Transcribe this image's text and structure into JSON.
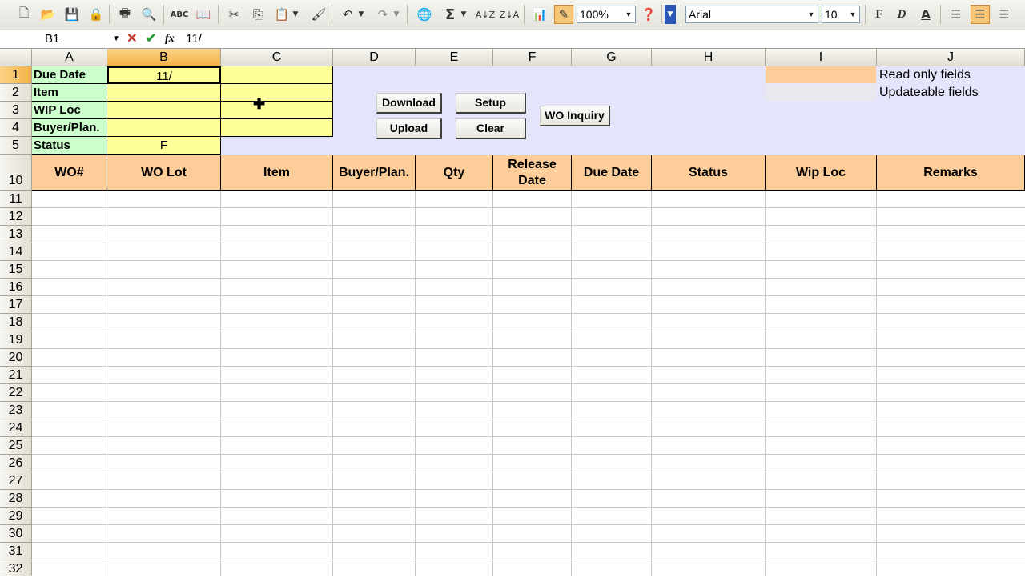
{
  "toolbar": {
    "icons": [
      "new-icon",
      "open-icon",
      "save-icon",
      "permission-icon",
      "print-icon",
      "print-preview-icon",
      "spelling-icon",
      "research-icon",
      "cut-icon",
      "copy-icon",
      "paste-icon",
      "format-painter-icon",
      "undo-icon",
      "redo-icon",
      "hyperlink-icon",
      "autosum-icon",
      "sort-ascending-icon",
      "sort-descending-icon",
      "chart-wizard-icon",
      "drawing-icon",
      "help-icon"
    ],
    "zoom": "100%",
    "font_name": "Arial",
    "font_size": "10",
    "bold": "F",
    "italic": "D",
    "underline": "A"
  },
  "formula_bar": {
    "name_box": "B1",
    "content": "11/"
  },
  "columns": [
    "A",
    "B",
    "C",
    "D",
    "E",
    "F",
    "G",
    "H",
    "I",
    "J"
  ],
  "rows": [
    "1",
    "2",
    "3",
    "4",
    "5",
    "10",
    "11",
    "12",
    "13",
    "14",
    "15",
    "16",
    "17",
    "18",
    "19",
    "20",
    "21",
    "22",
    "23",
    "24",
    "25",
    "26",
    "27",
    "28",
    "29",
    "30",
    "31",
    "32"
  ],
  "criteria": {
    "labels": [
      "Due Date",
      "Item",
      "WIP Loc",
      "Buyer/Plan.",
      "Status"
    ],
    "values": [
      "11/",
      "",
      "",
      "",
      "F"
    ]
  },
  "buttons": {
    "download": "Download",
    "setup": "Setup",
    "upload": "Upload",
    "clear": "Clear",
    "wo_inquiry": "WO Inquiry"
  },
  "legend": {
    "read_only": "Read only fields",
    "updateable": "Updateable fields"
  },
  "headers": [
    "WO#",
    "WO Lot",
    "Item",
    "Buyer/Plan.",
    "Qty",
    "Release Date",
    "Due Date",
    "Status",
    "Wip Loc",
    "Remarks"
  ],
  "colors": {
    "label_green": "#ccffcc",
    "input_yellow": "#ffff99",
    "header_orange": "#fccc99",
    "background_lavender": "#e4e4fa",
    "updateable_gray": "#e8e8ee"
  }
}
